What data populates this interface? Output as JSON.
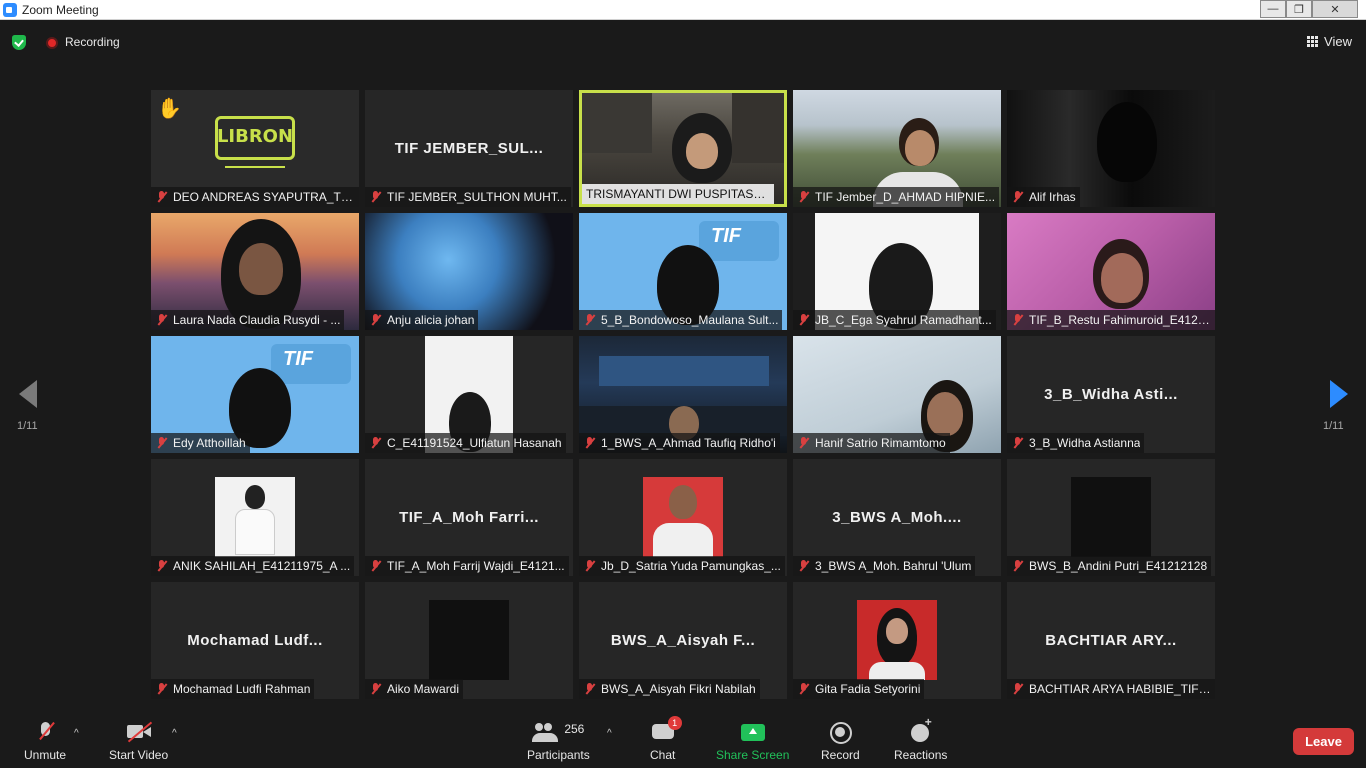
{
  "window": {
    "title": "Zoom Meeting",
    "controls": [
      "—",
      "❐",
      "✕"
    ]
  },
  "topbar": {
    "recording_label": "Recording",
    "view_label": "View"
  },
  "pagination": {
    "left_page": "1/11",
    "right_page": "1/11"
  },
  "tiles": [
    {
      "name": "DEO ANDREAS SYAPUTRA_TIF...",
      "big": "",
      "scene": "logo",
      "logo_text": "LIBRON",
      "raised_hand": "✋"
    },
    {
      "name": "TIF JEMBER_SULTHON MUHT...",
      "big": "TIF  JEMBER_SUL...",
      "scene": ""
    },
    {
      "name": "TRISMAYANTI DWI PUSPITASARI",
      "big": "",
      "scene": "classroom",
      "active": true
    },
    {
      "name": "TIF Jember_D_AHMAD HIPNIE...",
      "big": "",
      "scene": "hills"
    },
    {
      "name": "Alif Irhas",
      "big": "",
      "scene": "dark"
    },
    {
      "name": "Laura Nada Claudia Rusydi - ...",
      "big": "",
      "scene": "sunset"
    },
    {
      "name": "Anju alicia johan",
      "big": "",
      "scene": "blue-dark"
    },
    {
      "name": "5_B_Bondowoso_Maulana Sult...",
      "big": "",
      "scene": "blue"
    },
    {
      "name": "JB_C_Ega Syahrul Ramadhant...",
      "big": "",
      "scene": "white"
    },
    {
      "name": "TIF_B_Restu Fahimuroid_E4121...",
      "big": "",
      "scene": "pink"
    },
    {
      "name": "Edy Atthoillah",
      "big": "",
      "scene": "blue"
    },
    {
      "name": "C_E41191524_Ulfiatun Hasanah",
      "big": "",
      "scene": "portrait-white"
    },
    {
      "name": "1_BWS_A_Ahmad Taufiq Ridho'i",
      "big": "",
      "scene": "office"
    },
    {
      "name": "Hanif Satrio Rimamtomo",
      "big": "",
      "scene": "wall"
    },
    {
      "name": "3_B_Widha Astianna",
      "big": "3_B_Widha  Asti...",
      "scene": ""
    },
    {
      "name": "ANIK SAHILAH_E41211975_A ...",
      "big": "",
      "scene": "photo-white"
    },
    {
      "name": "TIF_A_Moh Farrij Wajdi_E4121...",
      "big": "TIF_A_Moh  Farri...",
      "scene": ""
    },
    {
      "name": "Jb_D_Satria Yuda Pamungkas_...",
      "big": "",
      "scene": "photo-red"
    },
    {
      "name": "3_BWS A_Moh. Bahrul 'Ulum",
      "big": "3_BWS  A_Moh....",
      "scene": ""
    },
    {
      "name": "BWS_B_Andini Putri_E41212128",
      "big": "",
      "scene": "photo-black"
    },
    {
      "name": "Mochamad Ludfi Rahman",
      "big": "Mochamad  Ludf...",
      "scene": ""
    },
    {
      "name": "Aiko Mawardi",
      "big": "",
      "scene": "photo-black"
    },
    {
      "name": "BWS_A_Aisyah Fikri Nabilah",
      "big": "BWS_A_Aisyah  F...",
      "scene": ""
    },
    {
      "name": "Gita Fadia Setyorini",
      "big": "",
      "scene": "photo-red-hijab"
    },
    {
      "name": "BACHTIAR ARYA HABIBIE_TIF_E...",
      "big": "BACHTIAR  ARY...",
      "scene": ""
    }
  ],
  "toolbar": {
    "unmute": "Unmute",
    "start_video": "Start Video",
    "participants": "Participants",
    "participant_count": "256",
    "chat": "Chat",
    "chat_badge": "1",
    "share_screen": "Share Screen",
    "record": "Record",
    "reactions": "Reactions",
    "leave": "Leave",
    "caret": "^"
  },
  "colors": {
    "accent_blue": "#2d8cff",
    "share_green": "#21c15a",
    "leave_red": "#d43a3a",
    "active_speaker": "#c8e04a",
    "logo_yellow": "#c8e04a"
  }
}
